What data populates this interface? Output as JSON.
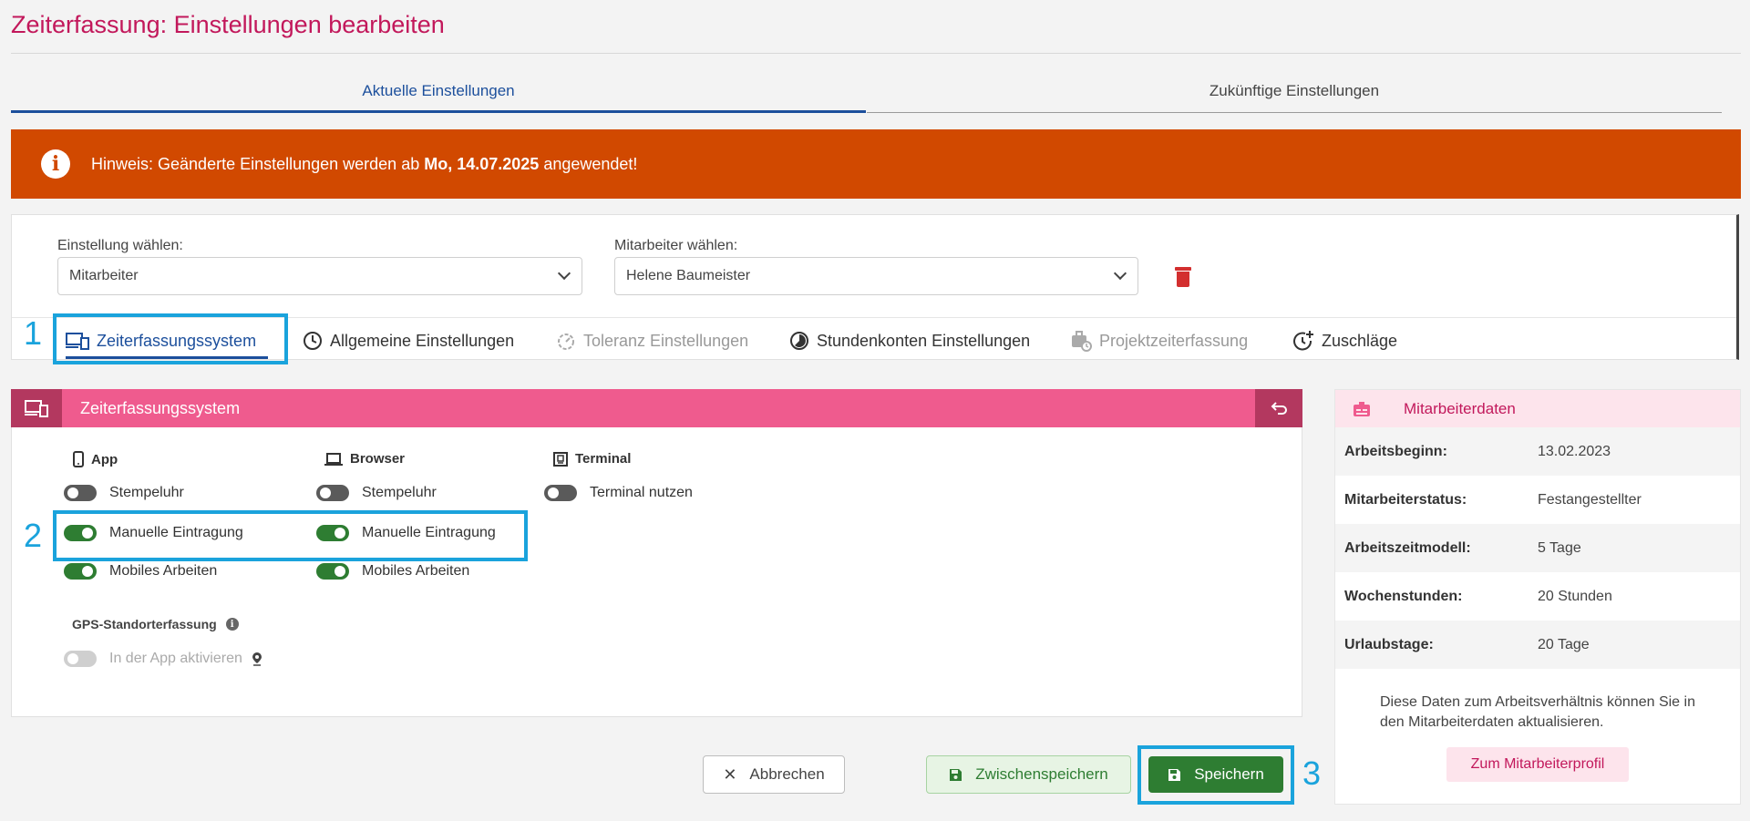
{
  "page": {
    "title": "Zeiterfassung: Einstellungen bearbeiten"
  },
  "top_tabs": [
    {
      "label": "Aktuelle Einstellungen",
      "active": true
    },
    {
      "label": "Zukünftige Einstellungen",
      "active": false
    }
  ],
  "alert": {
    "icon": "info-icon",
    "prefix": "Hinweis: Geänderte Einstellungen werden ab ",
    "date": "Mo, 14.07.2025",
    "suffix": " angewendet!",
    "color": "#d14900"
  },
  "selectors": {
    "setting_label": "Einstellung wählen:",
    "setting_value": "Mitarbeiter",
    "employee_label": "Mitarbeiter wählen:",
    "employee_value": "Helene Baumeister"
  },
  "sub_tabs": [
    {
      "label": "Zeiterfassungssystem",
      "icon": "devices-icon",
      "active": true
    },
    {
      "label": "Allgemeine Einstellungen",
      "icon": "clock-icon",
      "active": false
    },
    {
      "label": "Toleranz Einstellungen",
      "icon": "timer-icon",
      "active": false,
      "disabled": true
    },
    {
      "label": "Stundenkonten Einstellungen",
      "icon": "pie-clock-icon",
      "active": false
    },
    {
      "label": "Projektzeiterfassung",
      "icon": "briefcase-clock-icon",
      "active": false,
      "disabled": true
    },
    {
      "label": "Zuschläge",
      "icon": "clock-plus-icon",
      "active": false
    }
  ],
  "callouts": [
    "1",
    "2",
    "3"
  ],
  "panel": {
    "title": "Zeiterfassungssystem",
    "columns": [
      {
        "header": "App",
        "icon": "phone-icon",
        "toggles": [
          {
            "label": "Stempeluhr",
            "on": false
          },
          {
            "label": "Manuelle Eintragung",
            "on": true
          },
          {
            "label": "Mobiles Arbeiten",
            "on": true
          }
        ]
      },
      {
        "header": "Browser",
        "icon": "laptop-icon",
        "toggles": [
          {
            "label": "Stempeluhr",
            "on": false
          },
          {
            "label": "Manuelle Eintragung",
            "on": true
          },
          {
            "label": "Mobiles Arbeiten",
            "on": true
          }
        ]
      },
      {
        "header": "Terminal",
        "icon": "terminal-icon",
        "toggles": [
          {
            "label": "Terminal nutzen",
            "on": false
          }
        ]
      }
    ],
    "gps": {
      "header": "GPS-Standorterfassung",
      "toggle_label": "In der App aktivieren",
      "enabled": false
    }
  },
  "employee_data": {
    "title": "Mitarbeiterdaten",
    "rows": [
      {
        "key": "Arbeitsbeginn:",
        "value": "13.02.2023"
      },
      {
        "key": "Mitarbeiterstatus:",
        "value": "Festangestellter"
      },
      {
        "key": "Arbeitszeitmodell:",
        "value": "5 Tage"
      },
      {
        "key": "Wochenstunden:",
        "value": "20 Stunden"
      },
      {
        "key": "Urlaubstage:",
        "value": "20 Tage"
      }
    ],
    "note": "Diese Daten zum Arbeitsverhältnis können Sie in den Mitarbeiterdaten aktualisieren.",
    "profile_button": "Zum Mitarbeiterprofil"
  },
  "actions": {
    "cancel": "Abbrechen",
    "draft": "Zwischenspeichern",
    "save": "Speichern"
  },
  "colors": {
    "brand_pink": "#ef5b8e",
    "title_pink": "#c2185b",
    "accent_blue": "#1c4f9c",
    "callout_blue": "#1aa3dc",
    "success_green": "#2e7d32",
    "alert_orange": "#d14900"
  }
}
